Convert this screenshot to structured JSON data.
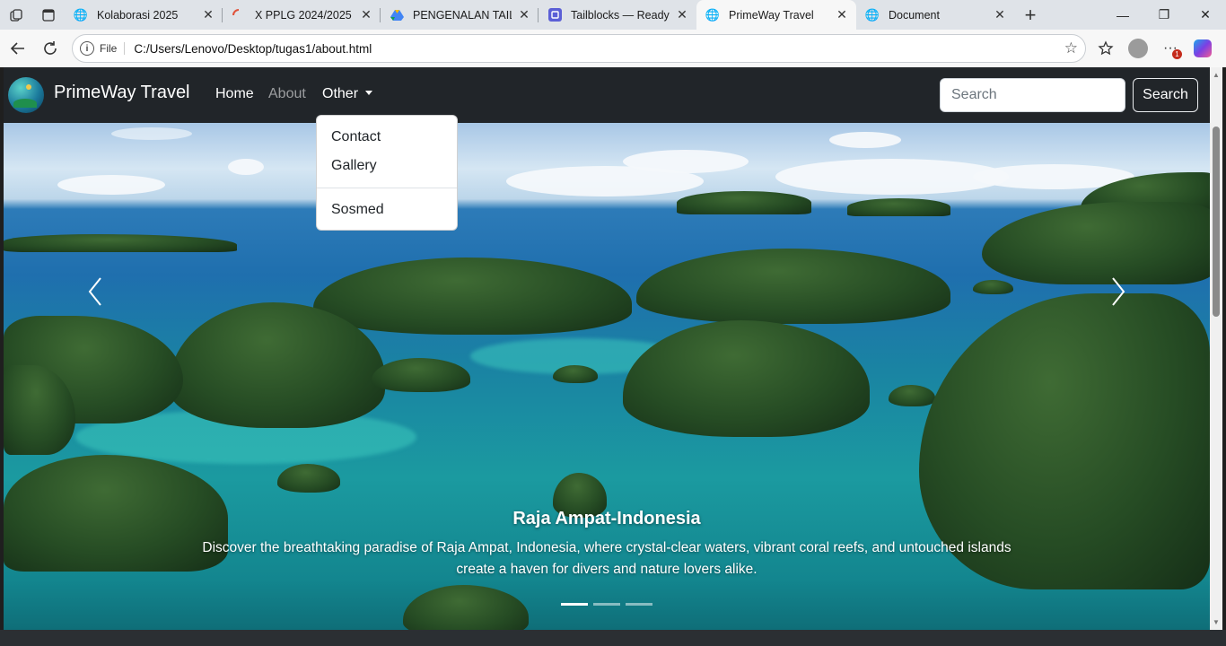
{
  "browser": {
    "tabs": [
      {
        "title": "Kolaborasi 2025",
        "icon": "globe-icon"
      },
      {
        "title": "X PPLG 2024/2025",
        "icon": "loading-icon"
      },
      {
        "title": "PENGENALAN TAILWI",
        "icon": "drive-icon"
      },
      {
        "title": "Tailblocks — Ready-tc",
        "icon": "tailblocks-icon"
      },
      {
        "title": "PrimeWay Travel",
        "icon": "globe-icon",
        "active": true
      },
      {
        "title": "Document",
        "icon": "globe-icon"
      }
    ],
    "address": {
      "scheme_label": "File",
      "url": "C:/Users/Lenovo/Desktop/tugas1/about.html"
    },
    "notification_count": "1"
  },
  "navbar": {
    "brand": "PrimeWay Travel",
    "links": [
      "Home",
      "About",
      "Other"
    ],
    "search_placeholder": "Search",
    "search_button": "Search"
  },
  "dropdown": {
    "items": [
      "Contact",
      "Gallery",
      "Sosmed"
    ]
  },
  "carousel": {
    "caption_title": "Raja Ampat-Indonesia",
    "caption_text": "Discover the breathtaking paradise of Raja Ampat, Indonesia, where crystal-clear waters, vibrant coral reefs, and untouched islands create a haven for divers and nature lovers alike.",
    "slide_count": 3,
    "active_slide": 1
  },
  "colors": {
    "navbar_bg": "#212529",
    "tab_strip": "#dfe3e8",
    "active_tab": "#f7f7f7"
  }
}
